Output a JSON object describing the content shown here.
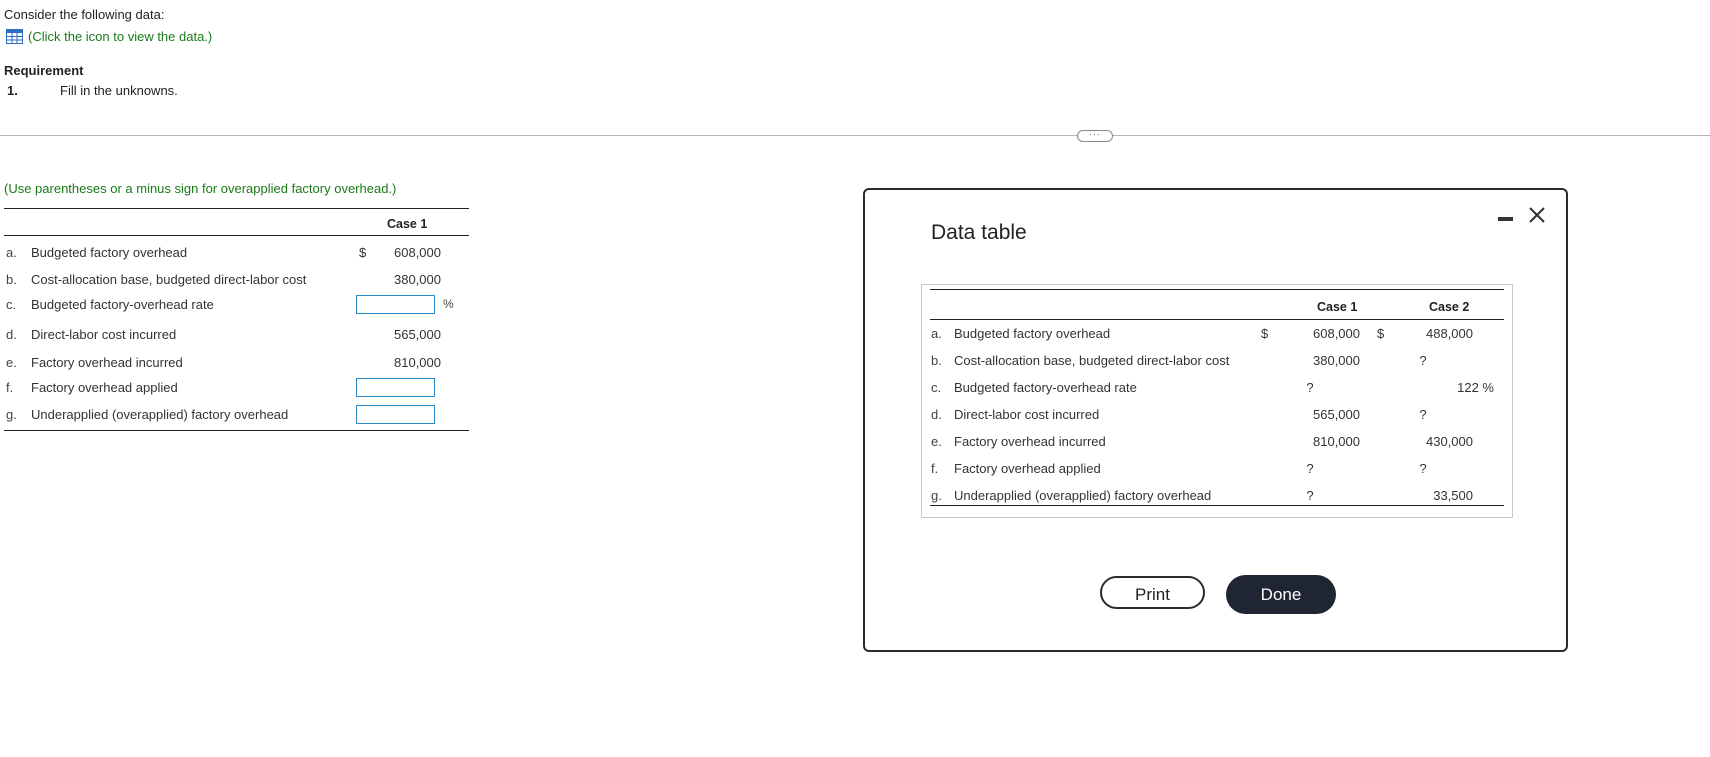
{
  "intro": "Consider the following data:",
  "data_link": "(Click the icon to view the data.)",
  "requirement": {
    "title": "Requirement",
    "number": "1.",
    "text": "Fill in the unknowns."
  },
  "instruction": "(Use parentheses or a minus sign for overapplied factory overhead.)",
  "answer_table": {
    "case_header": "Case 1",
    "rows": [
      {
        "letter": "a.",
        "label": "Budgeted factory overhead",
        "dollar": "$",
        "value": "608,000"
      },
      {
        "letter": "b.",
        "label": "Cost-allocation base, budgeted direct-labor cost",
        "dollar": "",
        "value": "380,000"
      },
      {
        "letter": "c.",
        "label": "Budgeted factory-overhead rate",
        "input": "",
        "unit": "%"
      },
      {
        "letter": "d.",
        "label": "Direct-labor cost incurred",
        "dollar": "",
        "value": "565,000"
      },
      {
        "letter": "e.",
        "label": "Factory overhead incurred",
        "dollar": "",
        "value": "810,000"
      },
      {
        "letter": "f.",
        "label": "Factory overhead applied",
        "input": ""
      },
      {
        "letter": "g.",
        "label": "Underapplied (overapplied) factory overhead",
        "input": ""
      }
    ]
  },
  "modal": {
    "title": "Data table",
    "headers": [
      "Case 1",
      "Case 2"
    ],
    "rows": [
      {
        "letter": "a.",
        "label": "Budgeted factory overhead",
        "d1": "$",
        "c1": "608,000",
        "d2": "$",
        "c2": "488,000"
      },
      {
        "letter": "b.",
        "label": "Cost-allocation base, budgeted direct-labor cost",
        "d1": "",
        "c1": "380,000",
        "d2": "",
        "c2": "?"
      },
      {
        "letter": "c.",
        "label": "Budgeted factory-overhead rate",
        "d1": "",
        "c1": "?",
        "d2": "",
        "c2": "122 %"
      },
      {
        "letter": "d.",
        "label": "Direct-labor cost incurred",
        "d1": "",
        "c1": "565,000",
        "d2": "",
        "c2": "?"
      },
      {
        "letter": "e.",
        "label": "Factory overhead incurred",
        "d1": "",
        "c1": "810,000",
        "d2": "",
        "c2": "430,000"
      },
      {
        "letter": "f.",
        "label": "Factory overhead applied",
        "d1": "",
        "c1": "?",
        "d2": "",
        "c2": "?"
      },
      {
        "letter": "g.",
        "label": "Underapplied (overapplied) factory overhead",
        "d1": "",
        "c1": "?",
        "d2": "",
        "c2": "33,500"
      }
    ],
    "print_label": "Print",
    "done_label": "Done"
  },
  "colors": {
    "accent_green": "#1a7a1a",
    "input_border": "#2a8ac4",
    "done_bg": "#1f2532",
    "grid_icon": "#2a6fc4"
  },
  "icons": {
    "data_icon": "table-grid-icon",
    "minimize": "minimize-icon",
    "close": "close-icon",
    "divider_handle": "ellipsis-icon"
  }
}
